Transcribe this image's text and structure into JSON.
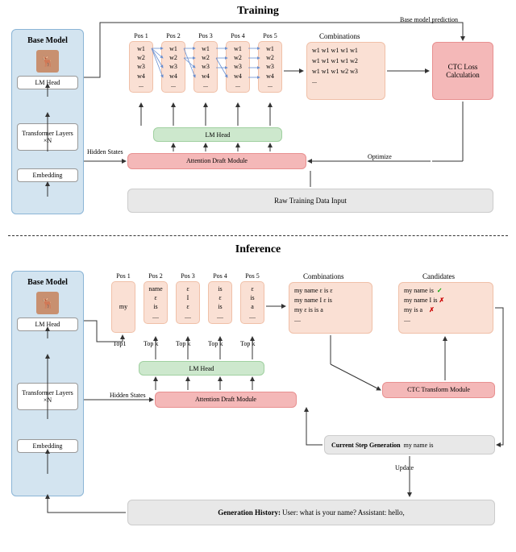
{
  "training": {
    "title": "Training",
    "base_model_title": "Base Model",
    "lm_head": "LM Head",
    "transformer": "Transformer Layers ×N",
    "embedding": "Embedding",
    "hidden_states": "Hidden States",
    "pos_labels": [
      "Pos 1",
      "Pos 2",
      "Pos 3",
      "Pos 4",
      "Pos 5"
    ],
    "token_cols": [
      [
        "w1",
        "w2",
        "w3",
        "w4",
        "..."
      ],
      [
        "w1",
        "w2",
        "w3",
        "w4",
        "..."
      ],
      [
        "w1",
        "w2",
        "w3",
        "w4",
        "..."
      ],
      [
        "w1",
        "w2",
        "w3",
        "w4",
        "..."
      ],
      [
        "w1",
        "w2",
        "w3",
        "w4",
        "..."
      ]
    ],
    "combinations_label": "Combinations",
    "combinations": [
      "w1 w1 w1 w1 w1",
      "w1 w1 w1 w1 w2",
      "w1 w1 w1 w2 w3",
      "..."
    ],
    "loss_box": "CTC Loss Calculation",
    "base_pred": "Base model prediction",
    "lm_head_green": "LM Head",
    "attn_draft": "Attention Draft Module",
    "raw_input": "Raw Training Data Input",
    "optimize": "Optimize"
  },
  "inference": {
    "title": "Inference",
    "base_model_title": "Base Model",
    "lm_head": "LM Head",
    "transformer": "Transformer Layers ×N",
    "embedding": "Embedding",
    "hidden_states": "Hidden States",
    "pos_labels": [
      "Pos 1",
      "Pos 2",
      "Pos 3",
      "Pos 4",
      "Pos 5"
    ],
    "token_cols": [
      [
        "my"
      ],
      [
        "name",
        "ε",
        "is",
        "...."
      ],
      [
        "ε",
        "I",
        "ε",
        "...."
      ],
      [
        "is",
        "ε",
        "is",
        "...."
      ],
      [
        "ε",
        "is",
        "a",
        "...."
      ]
    ],
    "top_labels": [
      "Top1",
      "Top k",
      "Top k",
      "Top k",
      "Top k"
    ],
    "combinations_label": "Combinations",
    "combinations": [
      "my name ε is ε",
      "my name I  ε is",
      "my  ε  is is a",
      "...."
    ],
    "candidates_label": "Candidates",
    "candidates": [
      {
        "text": "my name is",
        "mark": "✓"
      },
      {
        "text": "my name I is",
        "mark": "✗"
      },
      {
        "text": "my is a",
        "mark": "✗"
      },
      {
        "text": "....",
        "mark": ""
      }
    ],
    "lm_head_green": "LM Head",
    "attn_draft": "Attention Draft Module",
    "ctc_transform": "CTC Transform Module",
    "curr_step_label": "Current Step Generation",
    "curr_step_text": "my name is",
    "update": "Update",
    "history_label": "Generation History:",
    "history_text": "User: what is your name? Assistant: hello,"
  }
}
